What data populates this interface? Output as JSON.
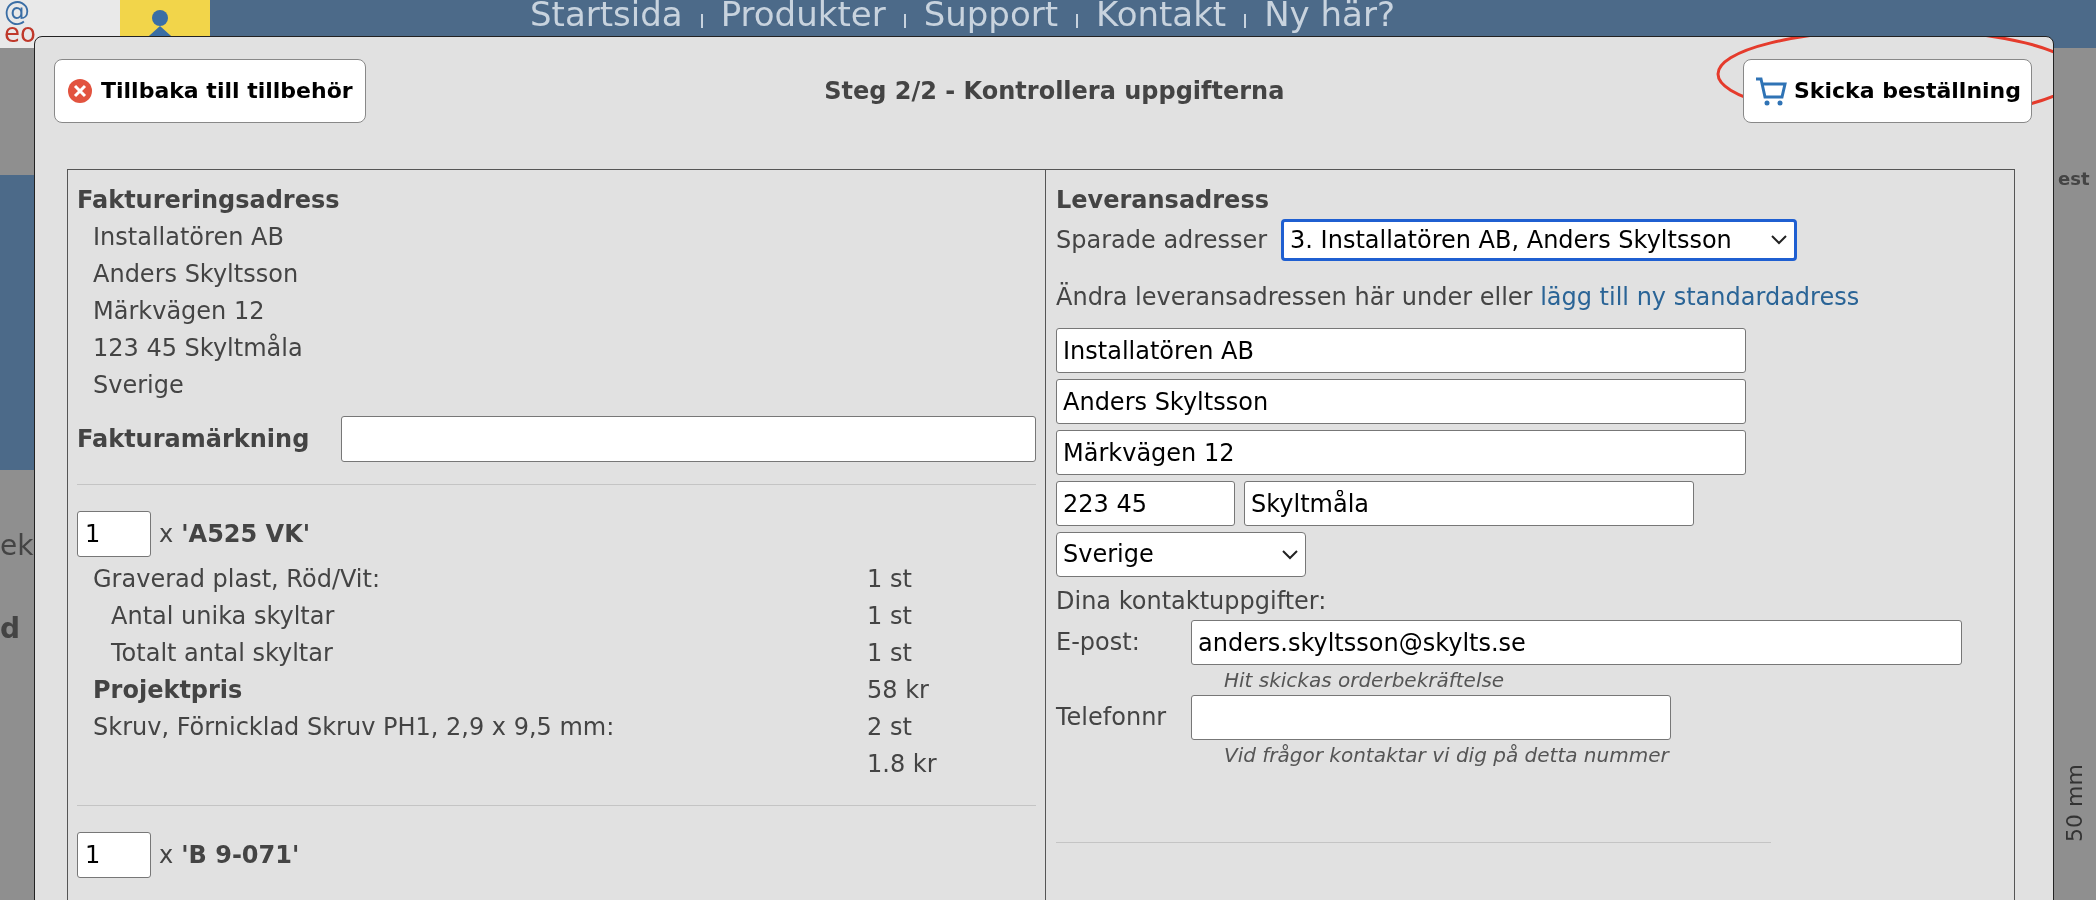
{
  "logo": {
    "symbol": "@",
    "text": "eo"
  },
  "nav": {
    "items": [
      "Startsida",
      "Produkter",
      "Support",
      "Kontakt",
      "Ny här?"
    ]
  },
  "background": {
    "fragments_left": [
      "ek",
      "d"
    ],
    "fragments_right": [
      "est",
      "50 mm"
    ]
  },
  "dialog": {
    "back_button": "Tillbaka till tillbehör",
    "title": "Steg 2/2 - Kontrollera uppgifterna",
    "submit_button": "Skicka beställning",
    "submit_circled": true
  },
  "billing": {
    "heading": "Faktureringsadress",
    "lines": [
      "Installatören AB",
      "Anders Skyltsson",
      "Märkvägen 12",
      "123 45 Skyltmåla",
      "Sverige"
    ],
    "invoice_mark_label": "Fakturamärkning"
  },
  "items": [
    {
      "quantity": "1",
      "times": "x",
      "name": "'A525 VK'",
      "rows": [
        {
          "kind": "main",
          "label": "Graverad plast, Röd/Vit:",
          "value": "1 st"
        },
        {
          "kind": "sub",
          "label": "Antal unika skyltar",
          "value": "1 st"
        },
        {
          "kind": "sub",
          "label": "Totalt antal skyltar",
          "value": "1 st"
        },
        {
          "kind": "total",
          "label": "Projektpris",
          "value": "58 kr"
        },
        {
          "kind": "main",
          "label": "Skruv, Förnicklad Skruv PH1, 2,9 x 9,5 mm:",
          "value": "2 st"
        },
        {
          "kind": "value_only",
          "value": "1.8 kr"
        }
      ]
    },
    {
      "quantity": "1",
      "times": "x",
      "name": "'B 9-071'"
    }
  ],
  "delivery": {
    "heading": "Leveransadress",
    "saved_label": "Sparade adresser",
    "saved_value": "3. Installatören AB, Anders Skyltsson",
    "note": "Ändra leveransadressen här under eller",
    "note_link": "lägg till ny standardadress",
    "company": "Installatören AB",
    "name": "Anders Skyltsson",
    "street": "Märkvägen 12",
    "zip": "223 45",
    "city": "Skyltmåla",
    "country": "Sverige",
    "contact_heading": "Dina kontaktuppgifter:",
    "email_label": "E-post:",
    "email": "anders.skyltsson@skylts.se",
    "email_hint": "Hit skickas orderbekräftelse",
    "phone_label": "Telefonnr",
    "phone_hint": "Vid frågor kontaktar vi dig på detta nummer"
  }
}
